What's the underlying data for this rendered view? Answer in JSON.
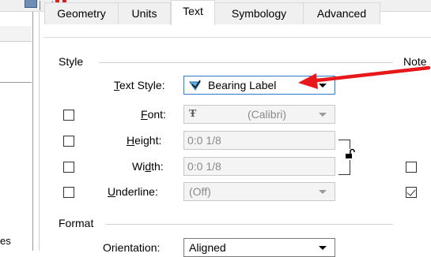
{
  "tabs": [
    {
      "label": "Geometry",
      "active": false
    },
    {
      "label": "Units",
      "active": false
    },
    {
      "label": "Text",
      "active": true
    },
    {
      "label": "Symbology",
      "active": false
    },
    {
      "label": "Advanced",
      "active": false
    }
  ],
  "left_panel": {
    "clipped_text": "es"
  },
  "groups": {
    "style_label": "Style",
    "notes_label": "Note",
    "format_label": "Format"
  },
  "fields": {
    "text_style": {
      "label_prefix": "",
      "label_underlined": "T",
      "label_rest": "ext Style:",
      "value": "Bearing Label",
      "icon": "text-style-icon"
    },
    "font": {
      "label_underlined": "F",
      "label_rest": "ont:",
      "value": "(Calibri)",
      "icon": "truetype-font-icon",
      "checked": false
    },
    "height": {
      "label_underlined": "H",
      "label_rest": "eight:",
      "value": "0:0 1/8",
      "checked": false
    },
    "width": {
      "label_prefix": "Wi",
      "label_underlined": "d",
      "label_rest": "th:",
      "value": "0:0 1/8",
      "checked": false
    },
    "underline": {
      "label_underlined": "U",
      "label_rest": "nderline:",
      "value": "(Off)",
      "checked": false
    },
    "orientation": {
      "label": "Orientation:",
      "value": "Aligned"
    }
  },
  "notes_checkboxes": [
    {
      "checked": false
    },
    {
      "checked": true
    }
  ],
  "colors": {
    "accent_border": "#2e7ad1",
    "annotation_arrow": "#e8181a"
  }
}
